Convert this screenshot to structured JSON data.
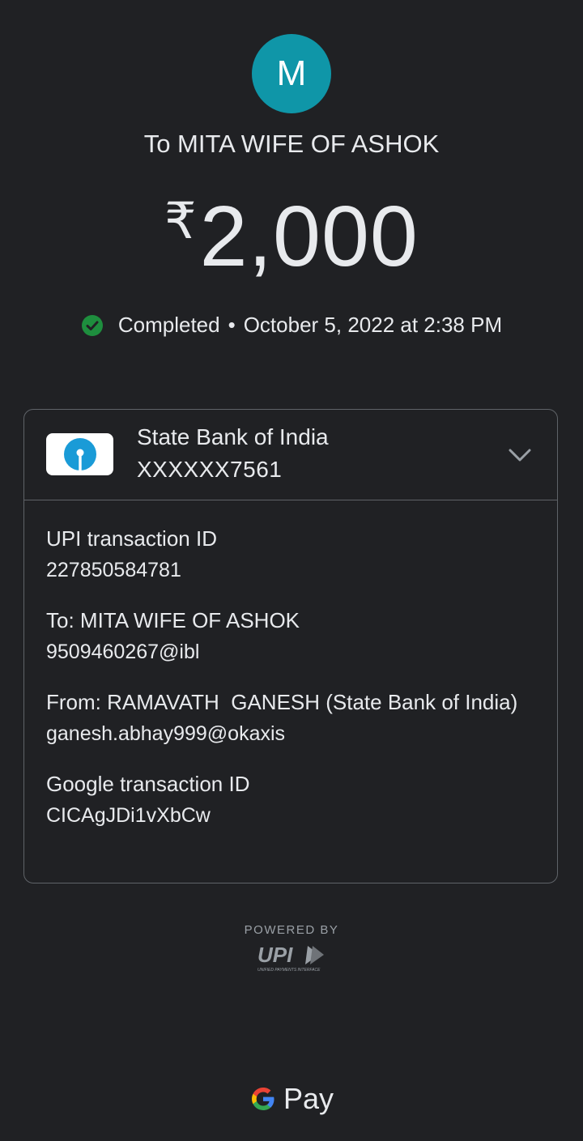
{
  "header": {
    "avatar_initial": "M",
    "recipient_title": "To MITA WIFE OF ASHOK",
    "currency_symbol": "₹",
    "amount": "2,000",
    "status": "Completed",
    "separator": "•",
    "datetime": "October 5, 2022 at 2:38 PM"
  },
  "bank": {
    "name": "State Bank of India",
    "account": "XXXXXX7561"
  },
  "details": [
    {
      "label": "UPI transaction ID",
      "value": "227850584781"
    },
    {
      "label": "To: MITA WIFE OF ASHOK",
      "value": "9509460267@ibl"
    },
    {
      "label": "From: RAMAVATH  GANESH (State Bank of India)",
      "value": "ganesh.abhay999@okaxis"
    },
    {
      "label": "Google transaction ID",
      "value": "CICAgJDi1vXbCw"
    }
  ],
  "footer": {
    "powered_by": "POWERED BY",
    "upi_logo_text": "UPI",
    "upi_logo_subtext": "UNIFIED PAYMENTS INTERFACE",
    "gpay_label": "Pay"
  },
  "colors": {
    "background": "#202124",
    "avatar": "#0f96a8",
    "success": "#1e8e3e",
    "border": "#5f6368"
  }
}
